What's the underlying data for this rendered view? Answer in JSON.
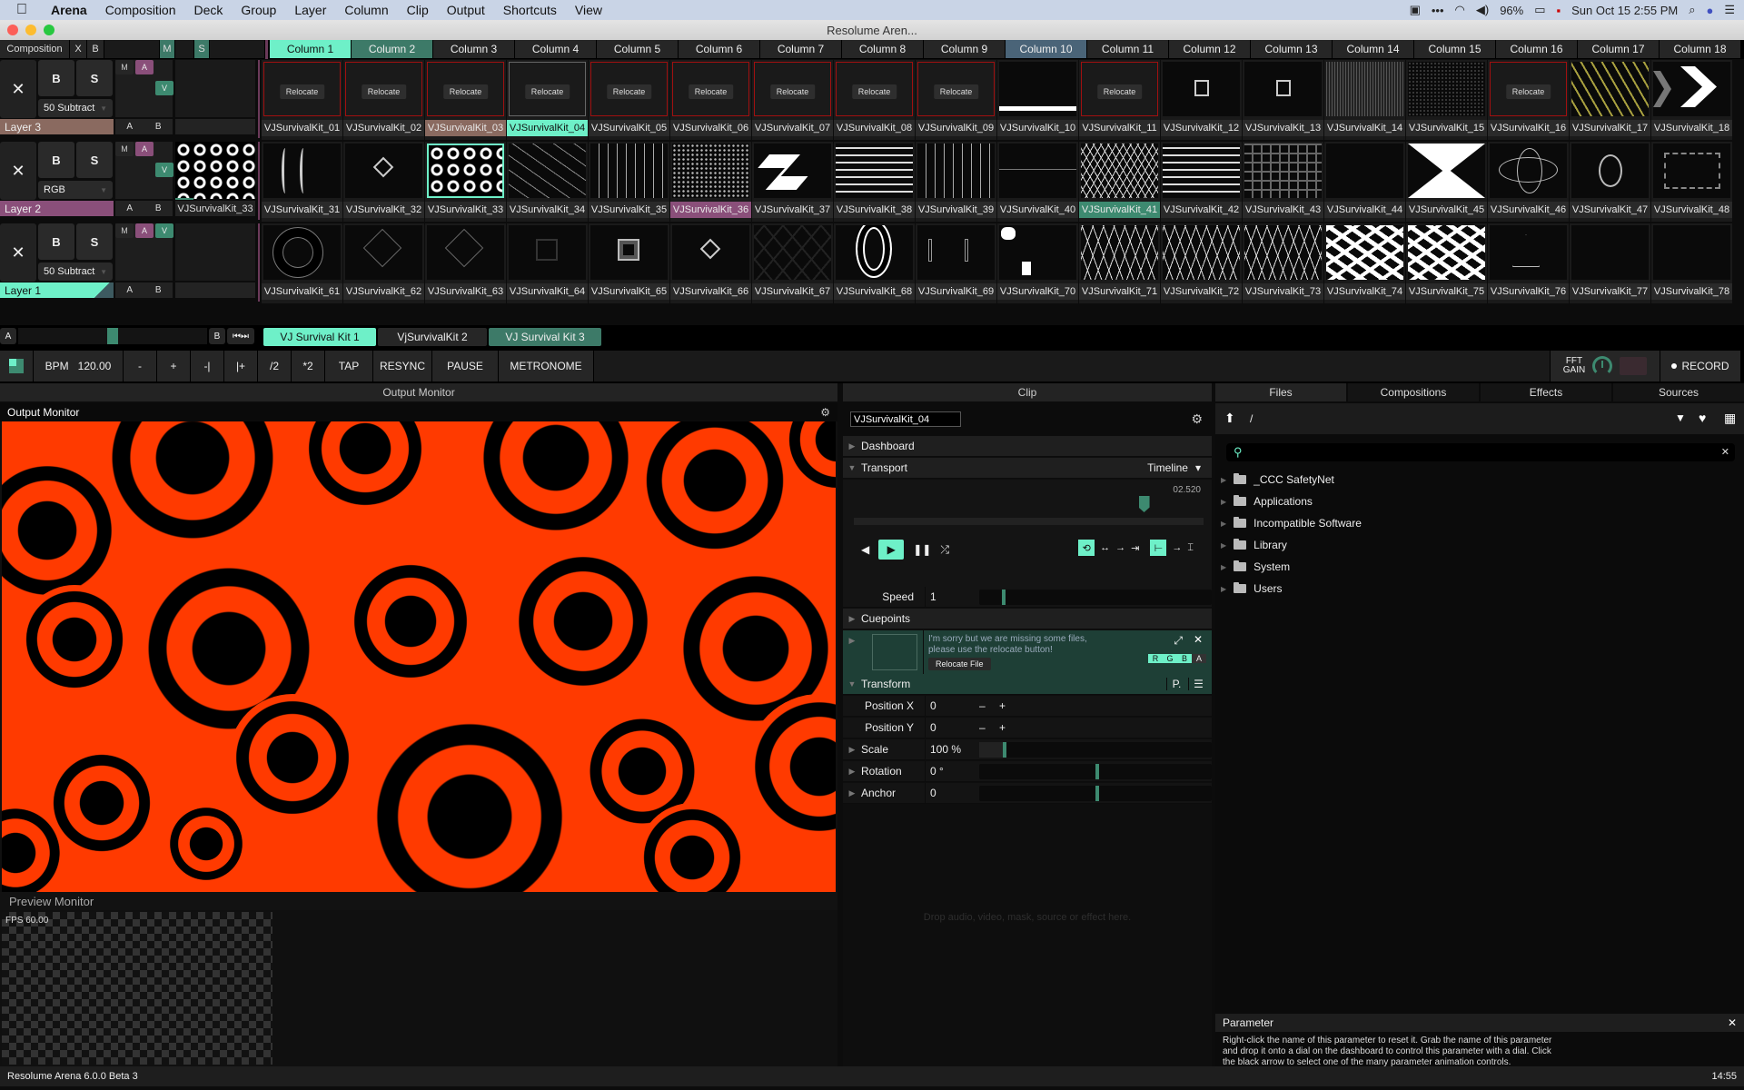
{
  "menubar": {
    "app": "Arena",
    "items": [
      "Composition",
      "Deck",
      "Group",
      "Layer",
      "Column",
      "Clip",
      "Output",
      "Shortcuts",
      "View"
    ],
    "battery": "96%",
    "datetime": "Sun Oct 15  2:55 PM"
  },
  "window": {
    "title": "Resolume Aren..."
  },
  "composition": {
    "label": "Composition",
    "x_label": "X",
    "b_label": "B",
    "m_label": "M",
    "s_label": "S",
    "columns": [
      "Column 1",
      "Column 2",
      "Column 3",
      "Column 4",
      "Column 5",
      "Column 6",
      "Column 7",
      "Column 8",
      "Column 9",
      "Column 10",
      "Column 11",
      "Column 12",
      "Column 13",
      "Column 14",
      "Column 15",
      "Column 16",
      "Column 17",
      "Column 18"
    ]
  },
  "layers": [
    {
      "name": "Layer 3",
      "blend": "50 Subtract",
      "color": "#8a6a60",
      "preview_clip": "",
      "clips": [
        {
          "name": "VJSurvivalKit_01",
          "missing": true
        },
        {
          "name": "VJSurvivalKit_02",
          "missing": true
        },
        {
          "name": "VJSurvivalKit_03",
          "missing": true,
          "state": "triggered-layer"
        },
        {
          "name": "VJSurvivalKit_04",
          "missing": true,
          "state": "selected"
        },
        {
          "name": "VJSurvivalKit_05",
          "missing": true
        },
        {
          "name": "VJSurvivalKit_06",
          "missing": true
        },
        {
          "name": "VJSurvivalKit_07",
          "missing": true
        },
        {
          "name": "VJSurvivalKit_08",
          "missing": true
        },
        {
          "name": "VJSurvivalKit_09",
          "missing": true
        },
        {
          "name": "VJSurvivalKit_10"
        },
        {
          "name": "VJSurvivalKit_11",
          "missing": true
        },
        {
          "name": "VJSurvivalKit_12"
        },
        {
          "name": "VJSurvivalKit_13"
        },
        {
          "name": "VJSurvivalKit_14"
        },
        {
          "name": "VJSurvivalKit_15"
        },
        {
          "name": "VJSurvivalKit_16",
          "missing": true
        },
        {
          "name": "VJSurvivalKit_17"
        },
        {
          "name": "VJSurvivalKit_18"
        }
      ]
    },
    {
      "name": "Layer 2",
      "blend": "RGB",
      "color": "#8a4f7a",
      "preview_clip": "VJSurvivalKit_33",
      "clips": [
        {
          "name": "VJSurvivalKit_31"
        },
        {
          "name": "VJSurvivalKit_32"
        },
        {
          "name": "VJSurvivalKit_33",
          "state": "playing"
        },
        {
          "name": "VJSurvivalKit_34"
        },
        {
          "name": "VJSurvivalKit_35"
        },
        {
          "name": "VJSurvivalKit_36",
          "state": "triggered-layer"
        },
        {
          "name": "VJSurvivalKit_37"
        },
        {
          "name": "VJSurvivalKit_38"
        },
        {
          "name": "VJSurvivalKit_39"
        },
        {
          "name": "VJSurvivalKit_40"
        },
        {
          "name": "VJSurvivalKit_41",
          "state": "column"
        },
        {
          "name": "VJSurvivalKit_42"
        },
        {
          "name": "VJSurvivalKit_43"
        },
        {
          "name": "VJSurvivalKit_44"
        },
        {
          "name": "VJSurvivalKit_45"
        },
        {
          "name": "VJSurvivalKit_46"
        },
        {
          "name": "VJSurvivalKit_47"
        },
        {
          "name": "VJSurvivalKit_48"
        }
      ]
    },
    {
      "name": "Layer 1",
      "blend": "50 Subtract",
      "color": "#6ef0c8",
      "preview_clip": "",
      "clips": [
        {
          "name": "VJSurvivalKit_61"
        },
        {
          "name": "VJSurvivalKit_62"
        },
        {
          "name": "VJSurvivalKit_63"
        },
        {
          "name": "VJSurvivalKit_64"
        },
        {
          "name": "VJSurvivalKit_65"
        },
        {
          "name": "VJSurvivalKit_66"
        },
        {
          "name": "VJSurvivalKit_67"
        },
        {
          "name": "VJSurvivalKit_68"
        },
        {
          "name": "VJSurvivalKit_69"
        },
        {
          "name": "VJSurvivalKit_70"
        },
        {
          "name": "VJSurvivalKit_71"
        },
        {
          "name": "VJSurvivalKit_72"
        },
        {
          "name": "VJSurvivalKit_73"
        },
        {
          "name": "VJSurvivalKit_74"
        },
        {
          "name": "VJSurvivalKit_75"
        },
        {
          "name": "VJSurvivalKit_76"
        },
        {
          "name": "VJSurvivalKit_77"
        },
        {
          "name": "VJSurvivalKit_78"
        }
      ]
    }
  ],
  "layer_controls": {
    "close": "✕",
    "b": "B",
    "s": "S",
    "m": "M",
    "a": "A",
    "v": "V",
    "ab_a": "A",
    "ab_b": "B",
    "relocate": "Relocate"
  },
  "crossfader": {
    "a": "A",
    "b": "B",
    "position": 0.5
  },
  "decks": [
    {
      "label": "VJ Survival Kit 1",
      "state": "active"
    },
    {
      "label": "VjSurvivalKit 2",
      "state": "normal"
    },
    {
      "label": "VJ Survival Kit 3",
      "state": "alt"
    }
  ],
  "transport": {
    "bpm_label": "BPM",
    "bpm": "120.00",
    "buttons": [
      "-",
      "+",
      "-|",
      "|+",
      "/2",
      "*2",
      "TAP",
      "RESYNC",
      "PAUSE",
      "METRONOME"
    ],
    "fft_label": "FFT",
    "gain_label": "GAIN",
    "record_label": "RECORD"
  },
  "output_monitor": {
    "header": "Output Monitor",
    "title": "Output Monitor"
  },
  "preview_monitor": {
    "title": "Preview Monitor",
    "fps": "FPS 60.00"
  },
  "clip_panel": {
    "header": "Clip",
    "name_value": "VJSurvivalKit_04",
    "dashboard": "Dashboard",
    "transport": "Transport",
    "timeline_mode": "Timeline",
    "time": "02.520",
    "playhead_fraction": 0.83,
    "speed_label": "Speed",
    "speed_value": "1",
    "cuepoints": "Cuepoints",
    "missing_msg_1": "I'm sorry but we are missing some files,",
    "missing_msg_2": "please use the relocate button!",
    "relocate_file": "Relocate File",
    "rgba": [
      "R",
      "G",
      "B",
      "A"
    ],
    "transform": "Transform",
    "transform_p": "P.",
    "params": [
      {
        "label": "Position X",
        "value": "0",
        "kind": "pm"
      },
      {
        "label": "Position Y",
        "value": "0",
        "kind": "pm"
      },
      {
        "label": "Scale",
        "value": "100 %",
        "kind": "slider",
        "fraction": 0.1
      },
      {
        "label": "Rotation",
        "value": "0 °",
        "kind": "slider",
        "fraction": 0.5
      },
      {
        "label": "Anchor",
        "value": "0",
        "kind": "slider",
        "fraction": 0.5
      }
    ],
    "minus": "–",
    "plus": "+",
    "drop_hint": "Drop audio, video, mask, source or effect here."
  },
  "browser": {
    "tabs": [
      "Files",
      "Compositions",
      "Effects",
      "Sources"
    ],
    "active_tab": "Files",
    "path": "/",
    "search_value": "",
    "folders": [
      "_CCC SafetyNet",
      "Applications",
      "Incompatible Software",
      "Library",
      "System",
      "Users"
    ]
  },
  "parameter_help": {
    "title": "Parameter",
    "text_1": "Right-click the name of this parameter to reset it. Grab the name of this parameter",
    "text_2": "and drop it onto a dial on the dashboard to control this parameter with a dial. Click",
    "text_3": "the black arrow to select one of the many parameter animation controls."
  },
  "statusbar": {
    "version": "Resolume Arena 6.0.0  Beta 3",
    "time": "14:55"
  },
  "colors": {
    "accent": "#6ef0c8",
    "accent_dark": "#3d8a70",
    "missing": "#a01010",
    "output_orange": "#ff3a00"
  }
}
